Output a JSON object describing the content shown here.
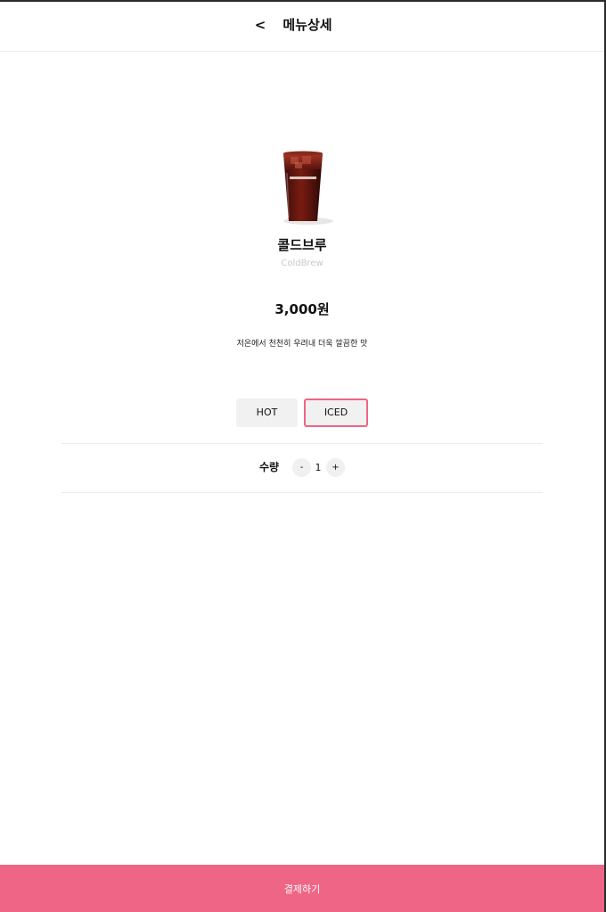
{
  "header": {
    "back_label": "<",
    "title": "메뉴상세"
  },
  "product": {
    "name": "콜드브루",
    "name_en": "ColdBrew",
    "price": "3,000원",
    "description": "저온에서 천천히 우려내 더욱 깔끔한 맛",
    "image_icon": "iced-coffee-cup-image"
  },
  "temperature": {
    "options": [
      {
        "label": "HOT",
        "selected": false
      },
      {
        "label": "ICED",
        "selected": true
      }
    ]
  },
  "quantity": {
    "label": "수량",
    "minus_label": "-",
    "value": "1",
    "plus_label": "+"
  },
  "footer": {
    "pay_label": "결제하기"
  },
  "colors": {
    "accent": "#ee6585",
    "option_bg": "#f1f1f1",
    "divider": "#ececec"
  }
}
